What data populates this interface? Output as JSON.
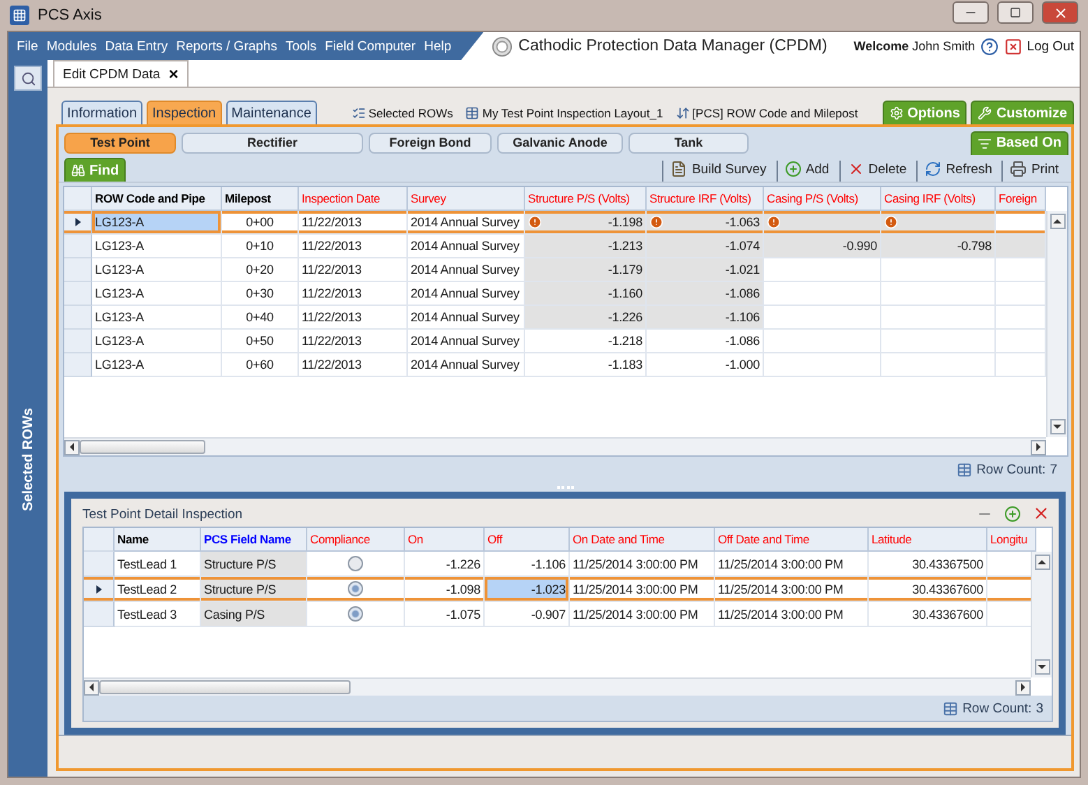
{
  "window": {
    "title": "PCS Axis"
  },
  "menu": [
    "File",
    "Modules",
    "Data Entry",
    "Reports / Graphs",
    "Tools",
    "Field Computer",
    "Help"
  ],
  "app_title": "Cathodic Protection Data Manager (CPDM)",
  "user": {
    "welcome": "Welcome",
    "name": "John Smith",
    "logout": "Log Out"
  },
  "sidebar": {
    "label": "Selected ROWs"
  },
  "document_tab": {
    "label": "Edit CPDM Data",
    "close": "×"
  },
  "tabs": [
    {
      "label": "Information",
      "selected": false
    },
    {
      "label": "Inspection",
      "selected": true
    },
    {
      "label": "Maintenance",
      "selected": false
    }
  ],
  "layout_links": [
    {
      "kind": "rows",
      "label": "Selected ROWs"
    },
    {
      "kind": "layout",
      "label": "My Test Point Inspection Layout_1"
    },
    {
      "kind": "sort",
      "label": "[PCS] ROW Code and Milepost"
    }
  ],
  "actions": [
    {
      "kind": "options",
      "label": "Options"
    },
    {
      "kind": "customize",
      "label": "Customize"
    }
  ],
  "subtabs": [
    {
      "label": "Test Point",
      "selected": true
    },
    {
      "label": "Rectifier",
      "selected": false
    },
    {
      "label": "Foreign Bond",
      "selected": false
    },
    {
      "label": "Galvanic Anode",
      "selected": false
    },
    {
      "label": "Tank",
      "selected": false
    }
  ],
  "based_on": "Based On",
  "find": "Find",
  "toolbar": [
    {
      "kind": "build",
      "label": "Build Survey"
    },
    {
      "kind": "add",
      "label": "Add"
    },
    {
      "kind": "delete",
      "label": "Delete"
    },
    {
      "kind": "refresh",
      "label": "Refresh"
    },
    {
      "kind": "print",
      "label": "Print"
    }
  ],
  "grid": {
    "columns": [
      {
        "label": "ROW Code and Pipe",
        "color": "#000000"
      },
      {
        "label": "Milepost",
        "color": "#000000"
      },
      {
        "label": "Inspection Date",
        "color": "#ff0000"
      },
      {
        "label": "Survey",
        "color": "#ff0000"
      },
      {
        "label": "Structure P/S (Volts)",
        "color": "#ff0000"
      },
      {
        "label": "Structure IRF (Volts)",
        "color": "#ff0000"
      },
      {
        "label": "Casing P/S (Volts)",
        "color": "#ff0000"
      },
      {
        "label": "Casing IRF (Volts)",
        "color": "#ff0000"
      },
      {
        "label": "Foreign",
        "color": "#ff0000"
      }
    ],
    "rows": [
      {
        "selected": true,
        "cells": [
          {
            "text": "LG123-A",
            "focused": true,
            "shaded": false,
            "alert": false
          },
          {
            "text": "0+00",
            "focused": false,
            "shaded": false,
            "alert": false
          },
          {
            "text": "11/22/2013",
            "focused": false,
            "shaded": false,
            "alert": false
          },
          {
            "text": "2014 Annual Survey",
            "focused": false,
            "shaded": false,
            "alert": false
          },
          {
            "text": "-1.198",
            "focused": false,
            "shaded": true,
            "alert": true
          },
          {
            "text": "-1.063",
            "focused": false,
            "shaded": true,
            "alert": true
          },
          {
            "focused": false,
            "shaded": true,
            "alert": true
          },
          {
            "focused": false,
            "shaded": true,
            "alert": true
          },
          {
            "focused": false,
            "shaded": false,
            "alert": false
          }
        ]
      },
      {
        "selected": false,
        "cells": [
          {
            "text": "LG123-A",
            "focused": false,
            "shaded": false,
            "alert": false
          },
          {
            "text": "0+10",
            "focused": false,
            "shaded": false,
            "alert": false
          },
          {
            "text": "11/22/2013",
            "focused": false,
            "shaded": false,
            "alert": false
          },
          {
            "text": "2014 Annual Survey",
            "focused": false,
            "shaded": false,
            "alert": false
          },
          {
            "text": "-1.213",
            "focused": false,
            "shaded": true,
            "alert": false
          },
          {
            "text": "-1.074",
            "focused": false,
            "shaded": true,
            "alert": false
          },
          {
            "text": "-0.990",
            "focused": false,
            "shaded": true,
            "alert": false
          },
          {
            "text": "-0.798",
            "focused": false,
            "shaded": true,
            "alert": false
          },
          {
            "focused": false,
            "shaded": true,
            "alert": false
          }
        ]
      },
      {
        "selected": false,
        "cells": [
          {
            "text": "LG123-A",
            "focused": false,
            "shaded": false,
            "alert": false
          },
          {
            "text": "0+20",
            "focused": false,
            "shaded": false,
            "alert": false
          },
          {
            "text": "11/22/2013",
            "focused": false,
            "shaded": false,
            "alert": false
          },
          {
            "text": "2014 Annual Survey",
            "focused": false,
            "shaded": false,
            "alert": false
          },
          {
            "text": "-1.179",
            "focused": false,
            "shaded": true,
            "alert": false
          },
          {
            "text": "-1.021",
            "focused": false,
            "shaded": true,
            "alert": false
          },
          {
            "focused": false,
            "shaded": false,
            "alert": false
          },
          {
            "focused": false,
            "shaded": false,
            "alert": false
          },
          {
            "focused": false,
            "shaded": false,
            "alert": false
          }
        ]
      },
      {
        "selected": false,
        "cells": [
          {
            "text": "LG123-A",
            "focused": false,
            "shaded": false,
            "alert": false
          },
          {
            "text": "0+30",
            "focused": false,
            "shaded": false,
            "alert": false
          },
          {
            "text": "11/22/2013",
            "focused": false,
            "shaded": false,
            "alert": false
          },
          {
            "text": "2014 Annual Survey",
            "focused": false,
            "shaded": false,
            "alert": false
          },
          {
            "text": "-1.160",
            "focused": false,
            "shaded": true,
            "alert": false
          },
          {
            "text": "-1.086",
            "focused": false,
            "shaded": true,
            "alert": false
          },
          {
            "focused": false,
            "shaded": false,
            "alert": false
          },
          {
            "focused": false,
            "shaded": false,
            "alert": false
          },
          {
            "focused": false,
            "shaded": false,
            "alert": false
          }
        ]
      },
      {
        "selected": false,
        "cells": [
          {
            "text": "LG123-A",
            "focused": false,
            "shaded": false,
            "alert": false
          },
          {
            "text": "0+40",
            "focused": false,
            "shaded": false,
            "alert": false
          },
          {
            "text": "11/22/2013",
            "focused": false,
            "shaded": false,
            "alert": false
          },
          {
            "text": "2014 Annual Survey",
            "focused": false,
            "shaded": false,
            "alert": false
          },
          {
            "text": "-1.226",
            "focused": false,
            "shaded": true,
            "alert": false
          },
          {
            "text": "-1.106",
            "focused": false,
            "shaded": true,
            "alert": false
          },
          {
            "focused": false,
            "shaded": false,
            "alert": false
          },
          {
            "focused": false,
            "shaded": false,
            "alert": false
          },
          {
            "focused": false,
            "shaded": false,
            "alert": false
          }
        ]
      },
      {
        "selected": false,
        "cells": [
          {
            "text": "LG123-A",
            "focused": false,
            "shaded": false,
            "alert": false
          },
          {
            "text": "0+50",
            "focused": false,
            "shaded": false,
            "alert": false
          },
          {
            "text": "11/22/2013",
            "focused": false,
            "shaded": false,
            "alert": false
          },
          {
            "text": "2014 Annual Survey",
            "focused": false,
            "shaded": false,
            "alert": false
          },
          {
            "text": "-1.218",
            "focused": false,
            "shaded": false,
            "alert": false
          },
          {
            "text": "-1.086",
            "focused": false,
            "shaded": false,
            "alert": false
          },
          {
            "focused": false,
            "shaded": false,
            "alert": false
          },
          {
            "focused": false,
            "shaded": false,
            "alert": false
          },
          {
            "focused": false,
            "shaded": false,
            "alert": false
          }
        ]
      },
      {
        "selected": false,
        "cells": [
          {
            "text": "LG123-A",
            "focused": false,
            "shaded": false,
            "alert": false
          },
          {
            "text": "0+60",
            "focused": false,
            "shaded": false,
            "alert": false
          },
          {
            "text": "11/22/2013",
            "focused": false,
            "shaded": false,
            "alert": false
          },
          {
            "text": "2014 Annual Survey",
            "focused": false,
            "shaded": false,
            "alert": false
          },
          {
            "text": "-1.183",
            "focused": false,
            "shaded": false,
            "alert": false
          },
          {
            "text": "-1.000",
            "focused": false,
            "shaded": false,
            "alert": false
          },
          {
            "focused": false,
            "shaded": false,
            "alert": false
          },
          {
            "focused": false,
            "shaded": false,
            "alert": false
          },
          {
            "focused": false,
            "shaded": false,
            "alert": false
          }
        ]
      }
    ],
    "row_count": {
      "label": "Row Count:",
      "value": "7"
    }
  },
  "detail": {
    "title": "Test Point Detail Inspection",
    "columns": [
      {
        "label": "Name",
        "color": "#000000",
        "shaded": false
      },
      {
        "label": "PCS Field Name",
        "color": "#0000ff",
        "shaded": true
      },
      {
        "label": "Compliance",
        "color": "#ff0000",
        "shaded": false
      },
      {
        "label": "On",
        "color": "#ff0000",
        "shaded": false
      },
      {
        "label": "Off",
        "color": "#ff0000",
        "shaded": false
      },
      {
        "label": "On Date and Time",
        "color": "#ff0000",
        "shaded": false
      },
      {
        "label": "Off Date and Time",
        "color": "#ff0000",
        "shaded": false
      },
      {
        "label": "Latitude",
        "color": "#ff0000",
        "shaded": false
      },
      {
        "label": "Longitu",
        "color": "#ff0000",
        "shaded": false
      }
    ],
    "rows": [
      {
        "selected": false,
        "cells": [
          {
            "kind": "text",
            "text": "TestLead 1",
            "focused": false
          },
          {
            "kind": "text",
            "text": "Structure P/S",
            "focused": false
          },
          {
            "kind": "radio",
            "checked": false,
            "focused": false
          },
          {
            "kind": "text",
            "text": "-1.226",
            "focused": false
          },
          {
            "kind": "text",
            "text": "-1.106",
            "focused": false
          },
          {
            "kind": "text",
            "text": "11/25/2014 3:00:00 PM",
            "focused": false
          },
          {
            "kind": "text",
            "text": "11/25/2014 3:00:00 PM",
            "focused": false
          },
          {
            "kind": "text",
            "text": "30.43367500",
            "focused": false
          },
          {
            "kind": "text",
            "focused": false
          }
        ]
      },
      {
        "selected": true,
        "cells": [
          {
            "kind": "text",
            "text": "TestLead 2",
            "focused": false
          },
          {
            "kind": "text",
            "text": "Structure P/S",
            "focused": false
          },
          {
            "kind": "radio",
            "checked": true,
            "focused": false
          },
          {
            "kind": "text",
            "text": "-1.098",
            "focused": false
          },
          {
            "kind": "text",
            "text": "-1.023",
            "focused": true
          },
          {
            "kind": "text",
            "text": "11/25/2014 3:00:00 PM",
            "focused": false
          },
          {
            "kind": "text",
            "text": "11/25/2014 3:00:00 PM",
            "focused": false
          },
          {
            "kind": "text",
            "text": "30.43367600",
            "focused": false
          },
          {
            "kind": "text",
            "focused": false
          }
        ]
      },
      {
        "selected": false,
        "cells": [
          {
            "kind": "text",
            "text": "TestLead 3",
            "focused": false
          },
          {
            "kind": "text",
            "text": "Casing P/S",
            "focused": false
          },
          {
            "kind": "radio",
            "checked": true,
            "focused": false
          },
          {
            "kind": "text",
            "text": "-1.075",
            "focused": false
          },
          {
            "kind": "text",
            "text": "-0.907",
            "focused": false
          },
          {
            "kind": "text",
            "text": "11/25/2014 3:00:00 PM",
            "focused": false
          },
          {
            "kind": "text",
            "text": "11/25/2014 3:00:00 PM",
            "focused": false
          },
          {
            "kind": "text",
            "text": "30.43367600",
            "focused": false
          },
          {
            "kind": "text",
            "focused": false
          }
        ]
      }
    ],
    "row_count": {
      "label": "Row Count:",
      "value": "3"
    }
  }
}
